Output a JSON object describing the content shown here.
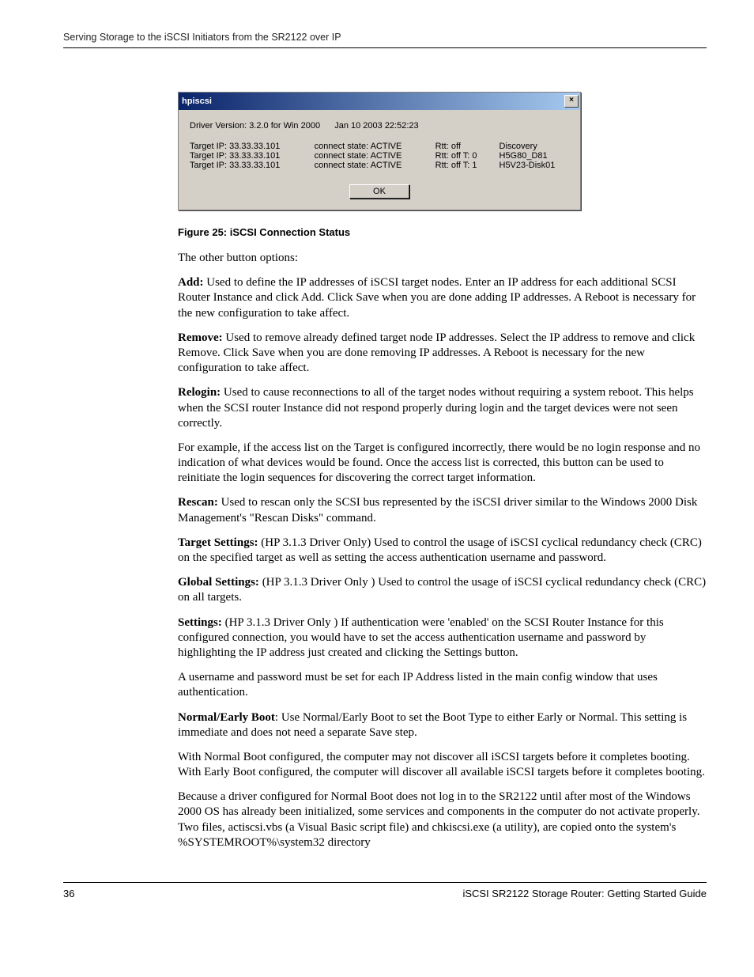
{
  "header": {
    "running_head": "Serving Storage to the iSCSI Initiators from the SR2122 over IP"
  },
  "dialog": {
    "title": "hpiscsi",
    "close_glyph": "×",
    "driver_version_label": "Driver Version: 3.2.0  for Win 2000",
    "driver_timestamp": "Jan 10 2003  22:52:23",
    "rows": [
      {
        "ip": "Target IP: 33.33.33.101",
        "state": "connect state: ACTIVE",
        "rtt": "Rtt: off",
        "name": "Discovery"
      },
      {
        "ip": "Target IP: 33.33.33.101",
        "state": "connect state: ACTIVE",
        "rtt": "Rtt: off  T: 0",
        "name": "H5G80_D81"
      },
      {
        "ip": "Target IP: 33.33.33.101",
        "state": "connect state: ACTIVE",
        "rtt": "Rtt: off  T: 1",
        "name": "H5V23-Disk01"
      }
    ],
    "ok_label": "OK"
  },
  "figure_caption": "Figure 25:  iSCSI Connection Status",
  "body": {
    "intro": "The other button options:",
    "add_term": "Add:",
    "add_text": "  Used to define the IP addresses of iSCSI target nodes. Enter an IP address for each additional SCSI Router Instance and click Add. Click Save when you are done adding IP addresses. A Reboot is necessary for the new configuration to take affect.",
    "remove_term": "Remove:",
    "remove_text": " Used to remove already defined target node IP addresses. Select the IP address to remove and click Remove. Click Save when you are done removing IP addresses. A Reboot is necessary for the new configuration to take affect.",
    "relogin_term": "Relogin:",
    "relogin_text": "  Used to cause reconnections to all of the target nodes without requiring a system reboot. This helps when the SCSI router Instance did not respond properly during login and the target devices were not seen correctly.",
    "relogin_example": "For example, if the access list on the Target is configured incorrectly, there would be no login response and no indication of what devices would be found. Once the access list is corrected, this button can be used to reinitiate the login sequences for discovering the correct target information.",
    "rescan_term": "Rescan:",
    "rescan_text": "  Used to rescan only the SCSI bus represented by the iSCSI driver similar to the Windows 2000 Disk Management's \"Rescan Disks\" command.",
    "target_settings_term": "Target Settings:",
    "target_settings_text": "  (HP 3.1.3 Driver Only) Used to control the usage of iSCSI cyclical redundancy check (CRC) on the specified target as well as setting the access authentication username and password.",
    "global_settings_term": "Global Settings:",
    "global_settings_text": "  (HP 3.1.3 Driver Only ) Used to control the usage of iSCSI cyclical redundancy check (CRC) on all targets.",
    "settings_term": "Settings:",
    "settings_text": " (HP 3.1.3 Driver Only ) If authentication were 'enabled' on the SCSI Router Instance for this configured connection, you would have to set the access authentication username and password by highlighting the IP address just created and clicking the Settings button.",
    "settings_note": "A username and password must be set for each IP Address listed in the main config window that uses authentication.",
    "normal_term": "Normal/Early Boot",
    "normal_text": ":  Use Normal/Early Boot to set the Boot Type to either Early or Normal. This setting is immediate and does not need a separate Save step.",
    "normal_p2": "With Normal Boot configured, the computer may not discover all iSCSI targets before it completes booting. With Early Boot configured, the computer will discover all available iSCSI targets before it completes booting.",
    "normal_p3": "Because a driver configured for Normal Boot does not log in to the SR2122 until after most of the Windows 2000 OS has already been initialized, some services and components in the computer do not activate properly. Two files, actiscsi.vbs (a Visual Basic script file) and chkiscsi.exe (a utility), are copied onto the system's %SYSTEMROOT%\\system32 directory"
  },
  "footer": {
    "page_number": "36",
    "doc_title": "iSCSI SR2122 Storage Router: Getting Started Guide"
  }
}
